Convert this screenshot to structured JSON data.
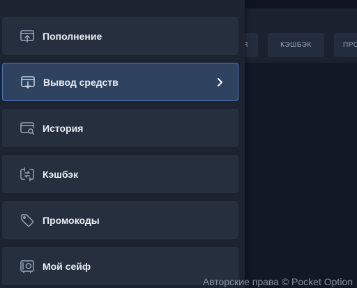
{
  "background_tabs": [
    {
      "label": "Я"
    },
    {
      "label": "КЭШБЭК"
    },
    {
      "label": "ПРО"
    }
  ],
  "menu": {
    "items": [
      {
        "label": "Пополнение",
        "icon": "deposit-icon",
        "active": false
      },
      {
        "label": "Вывод средств",
        "icon": "withdraw-icon",
        "active": true
      },
      {
        "label": "История",
        "icon": "history-icon",
        "active": false
      },
      {
        "label": "Кэшбэк",
        "icon": "cashback-icon",
        "active": false
      },
      {
        "label": "Промокоды",
        "icon": "tag-icon",
        "active": false
      },
      {
        "label": "Мой сейф",
        "icon": "safe-icon",
        "active": false
      }
    ]
  },
  "footer": {
    "copyright": "Авторские права © Pocket Option"
  },
  "colors": {
    "panel_bg": "#1c2431",
    "item_bg": "#252f3d",
    "active_bg": "#2f4361",
    "active_border": "#4a7ac0",
    "icon_stroke": "#9aa6b9",
    "text": "#e8edf4"
  }
}
